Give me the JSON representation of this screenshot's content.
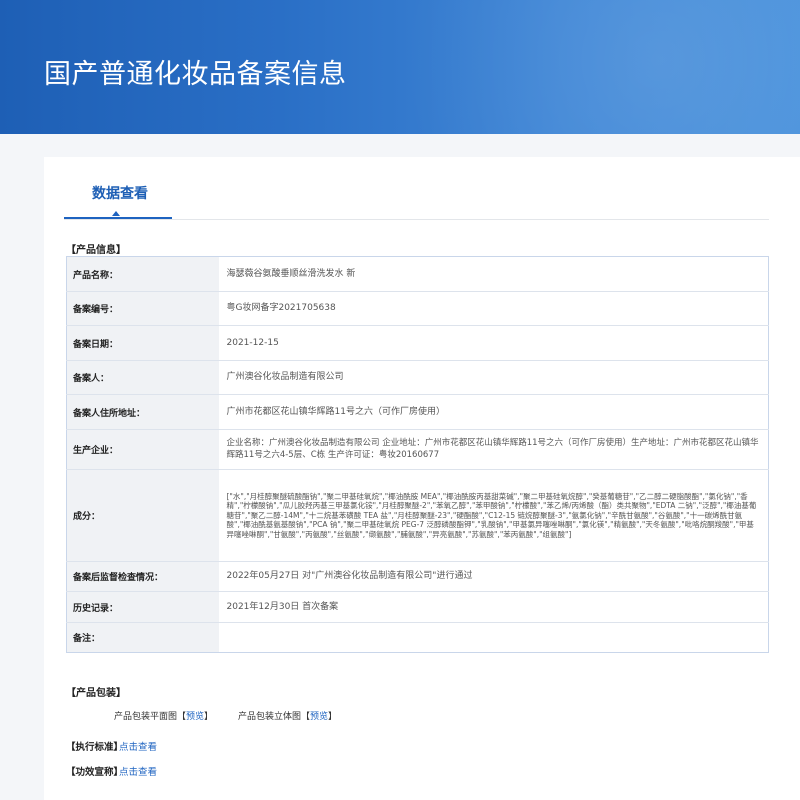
{
  "banner": {
    "title": "国产普通化妆品备案信息"
  },
  "tabs": [
    {
      "label": "数据查看"
    }
  ],
  "product_section": {
    "heading": "【产品信息】"
  },
  "rows": [
    {
      "label": "产品名称：",
      "value": "海瑟薇谷氨酸垂顺丝滑洗发水 新"
    },
    {
      "label": "备案编号：",
      "value": "粤G妆网备字2021705638"
    },
    {
      "label": "备案日期：",
      "value": "2021-12-15"
    },
    {
      "label": "备案人：",
      "value": "广州澳谷化妆品制造有限公司"
    },
    {
      "label": "备案人住所地址：",
      "value": "广州市花都区花山镇华辉路11号之六（可作厂房使用）"
    },
    {
      "label": "生产企业：",
      "value": "企业名称：广州澳谷化妆品制造有限公司 企业地址：广州市花都区花山镇华辉路11号之六（可作厂房使用）生产地址：广州市花都区花山镇华辉路11号之六4-5层、C栋 生产许可证：粤妆20160677"
    },
    {
      "label": "成分：",
      "value": "[\"水\",\"月桂醇聚醚硫酸酯钠\",\"聚二甲基硅氧烷\",\"椰油酰胺 MEA\",\"椰油酰胺丙基甜菜碱\",\"聚二甲基硅氧烷醇\",\"癸基葡糖苷\",\"乙二醇二硬脂酸酯\",\"氯化钠\",\"香精\",\"柠檬酸钠\",\"瓜儿胶羟丙基三甲基氯化铵\",\"月桂醇聚醚-2\",\"苯氧乙醇\",\"苯甲酸钠\",\"柠檬酸\",\"苯乙烯/丙烯酸（酯）类共聚物\",\"EDTA 二钠\",\"泛醇\",\"椰油基葡糖苷\",\"聚乙二醇-14M\",\"十二烷基苯磺酸 TEA 盐\",\"月桂醇聚醚-23\",\"硬酯酸\",\"C12-15 链烷醇聚醚-3\",\"氨氯化钠\",\"辛酰甘氨酸\",\"谷氨酸\",\"十一碳烯酰甘氨酸\",\"椰油酰基氨基酸钠\",\"PCA 钠\",\"聚二甲基硅氧烷 PEG-7 泛醇磷酸酯钾\",\"乳酸钠\",\"甲基氯异噻唑啉酮\",\"氯化镁\",\"精氨酸\",\"天冬氨酸\",\"吡咯烷酮羧酸\",\"甲基异噻唑啉酮\",\"甘氨酸\",\"丙氨酸\",\"丝氨酸\",\"缬氨酸\",\"脯氨酸\",\"异亮氨酸\",\"苏氨酸\",\"苯丙氨酸\",\"组氨酸\"]"
    },
    {
      "label": "备案后监督检查情况：",
      "value": "2022年05月27日 对\"广州澳谷化妆品制造有限公司\"进行通过"
    },
    {
      "label": "历史记录：",
      "value": "2021年12月30日 首次备案"
    },
    {
      "label": "备注：",
      "value": ""
    }
  ],
  "packaging": {
    "heading": "【产品包装】",
    "items": [
      {
        "label": "产品包装平面图",
        "bracket_open": "【",
        "link": "预览",
        "bracket_close": "】"
      },
      {
        "label": "产品包装立体图",
        "bracket_open": "【",
        "link": "预览",
        "bracket_close": "】"
      }
    ]
  },
  "standards": {
    "heading": "【执行标准】",
    "link": "点击查看"
  },
  "efficacy": {
    "heading": "【功效宣称】",
    "link": "点击查看"
  }
}
